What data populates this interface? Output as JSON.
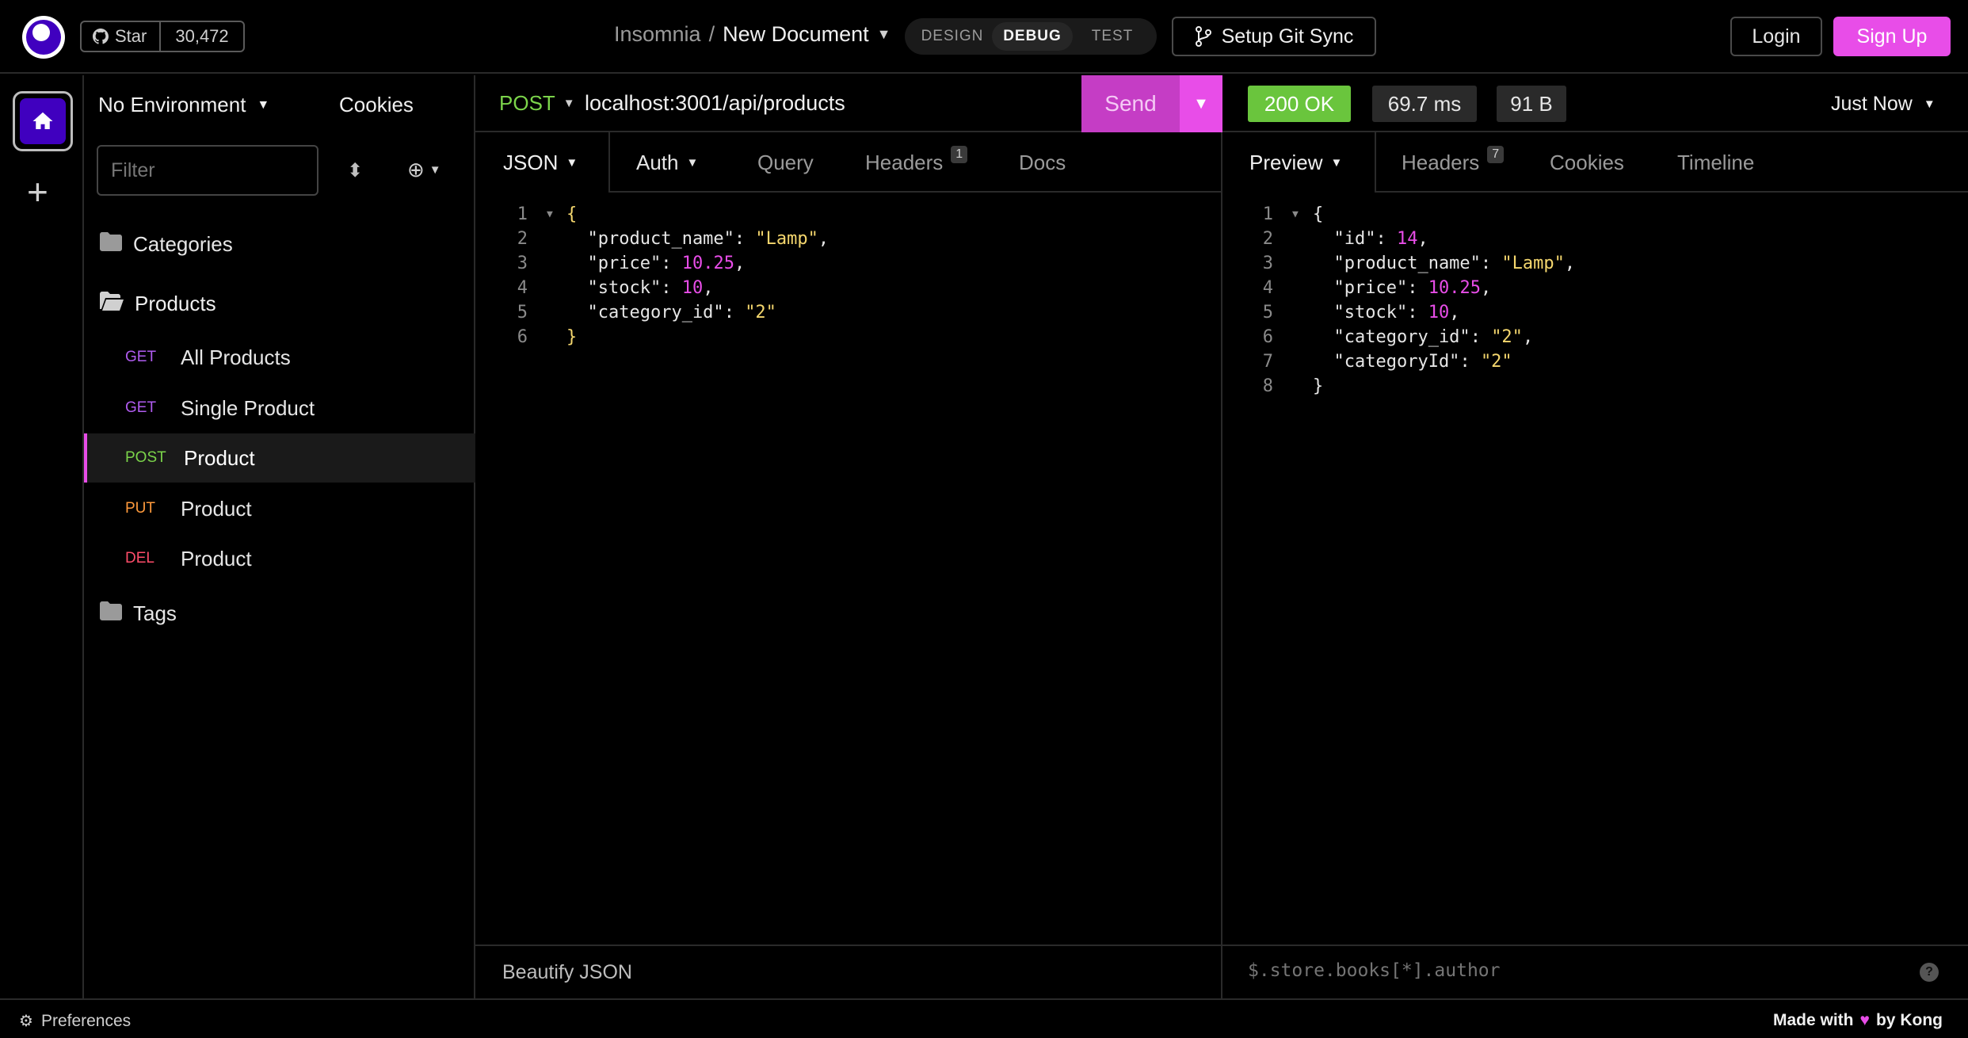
{
  "topbar": {
    "star_label": "Star",
    "star_count": "30,472",
    "breadcrumb_app": "Insomnia",
    "breadcrumb_sep": "/",
    "document_name": "New Document",
    "modes": [
      "DESIGN",
      "DEBUG",
      "TEST"
    ],
    "active_mode": "DEBUG",
    "git_sync": "Setup Git Sync",
    "login": "Login",
    "signup": "Sign Up"
  },
  "sidebar": {
    "environment": "No Environment",
    "cookies": "Cookies",
    "filter_placeholder": "Filter",
    "folders": {
      "categories": "Categories",
      "products": "Products",
      "tags": "Tags"
    },
    "requests": [
      {
        "method": "GET",
        "name": "All Products"
      },
      {
        "method": "GET",
        "name": "Single Product"
      },
      {
        "method": "POST",
        "name": "Product"
      },
      {
        "method": "PUT",
        "name": "Product"
      },
      {
        "method": "DEL",
        "name": "Product"
      }
    ]
  },
  "request": {
    "method": "POST",
    "url": "localhost:3001/api/products",
    "send": "Send",
    "tabs": {
      "body": "JSON",
      "auth": "Auth",
      "query": "Query",
      "headers": "Headers",
      "headers_count": "1",
      "docs": "Docs"
    },
    "body_lines": [
      "{",
      "  \"product_name\": \"Lamp\",",
      "  \"price\": 10.25,",
      "  \"stock\": 10,",
      "  \"category_id\": \"2\"",
      "}"
    ],
    "footer": "Beautify JSON"
  },
  "response": {
    "status": "200 OK",
    "time": "69.7 ms",
    "size": "91 B",
    "when": "Just Now",
    "tabs": {
      "preview": "Preview",
      "headers": "Headers",
      "headers_count": "7",
      "cookies": "Cookies",
      "timeline": "Timeline"
    },
    "body_lines": [
      "{",
      "  \"id\": 14,",
      "  \"product_name\": \"Lamp\",",
      "  \"price\": 10.25,",
      "  \"stock\": 10,",
      "  \"category_id\": \"2\",",
      "  \"categoryId\": \"2\"",
      "}"
    ],
    "filter_placeholder": "$.store.books[*].author",
    "help": "?"
  },
  "statusbar": {
    "preferences": "Preferences",
    "made_with": "Made with",
    "by": "by Kong"
  },
  "colors": {
    "accent": "#e84de8",
    "brand": "#4000bf",
    "success": "#6ac53d"
  }
}
